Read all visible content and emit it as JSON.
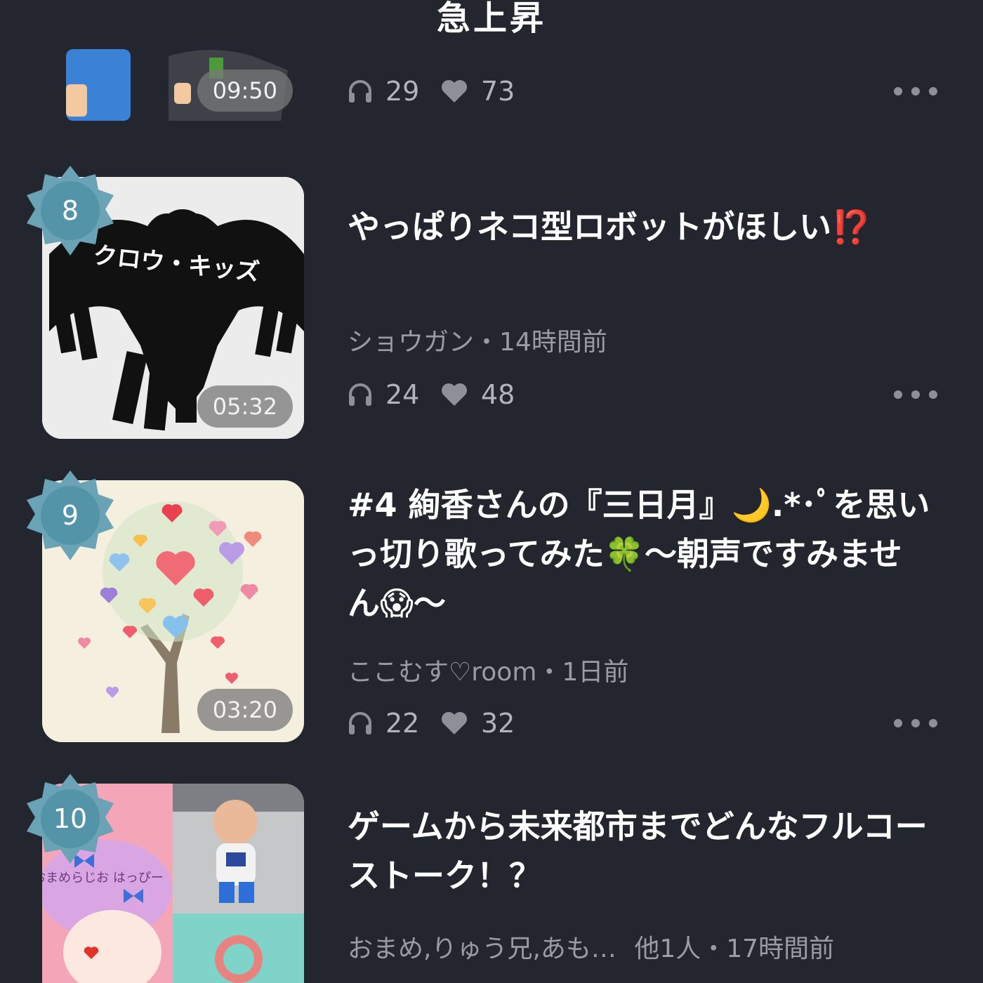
{
  "header": {
    "title": "急上昇"
  },
  "items": [
    {
      "duration": "09:50",
      "plays": "29",
      "likes": "73"
    },
    {
      "rank": "8",
      "title": "やっぱりネコ型ロボットがほしい⁉️",
      "thumb_text": "クロウ・キッズ",
      "author": "ショウガン",
      "time": "14時間前",
      "duration": "05:32",
      "plays": "24",
      "likes": "48"
    },
    {
      "rank": "9",
      "title": "#4 絢香さんの『三日月』🌙.*･ﾟを思いっ切り歌ってみた🍀～朝声ですみません😱～",
      "author": "ここむす♡room",
      "time": "1日前",
      "duration": "03:20",
      "plays": "22",
      "likes": "32"
    },
    {
      "rank": "10",
      "title": "ゲームから未来都市までどんなフルコーストーク！？",
      "author": "おまめ,りゅう兄,あも…",
      "author_extra": "他1人",
      "time": "17時間前",
      "thumb_text": "おまめらじお はっぴー"
    }
  ],
  "separator": "・",
  "colors": {
    "background": "#23262f",
    "badge": "#6aa3b5",
    "meta_text": "#9a9ca3",
    "accent_red": "#e0342b"
  }
}
